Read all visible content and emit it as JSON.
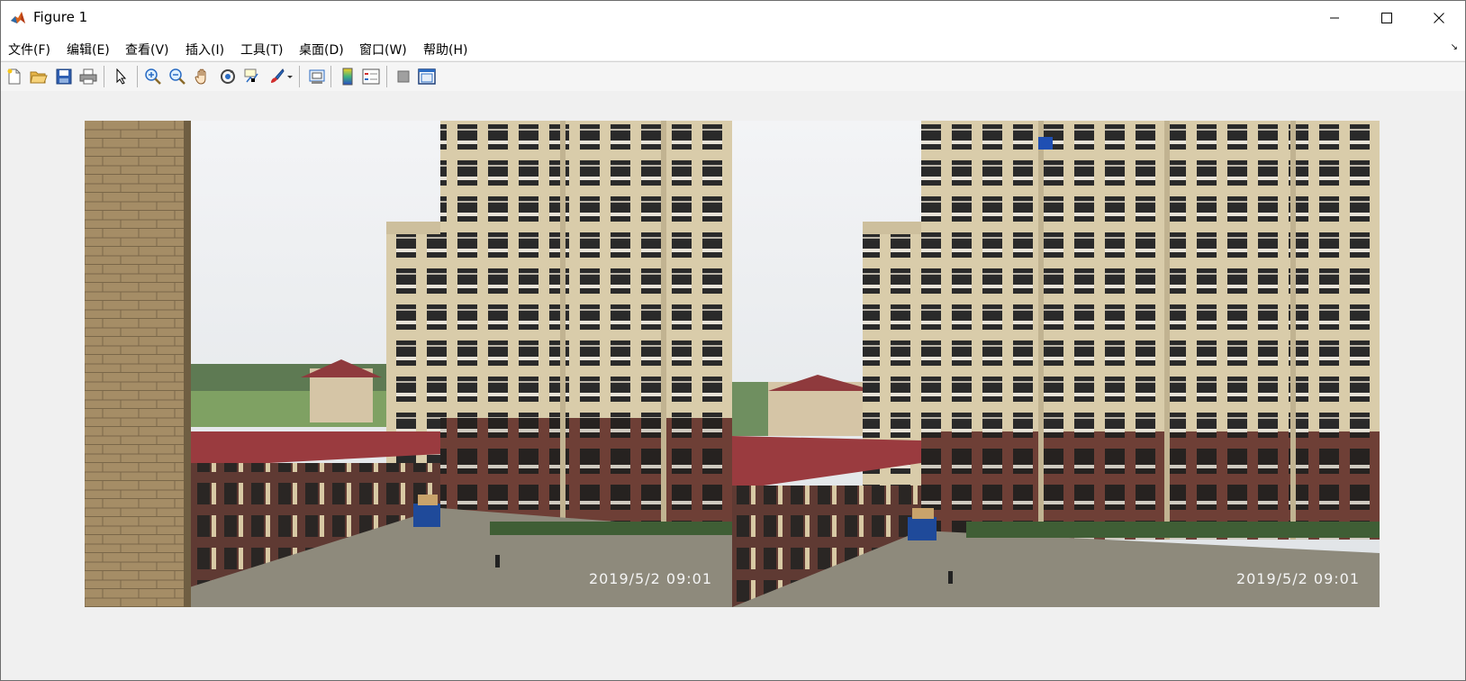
{
  "window": {
    "title": "Figure 1"
  },
  "menu": [
    "文件(F)",
    "编辑(E)",
    "查看(V)",
    "插入(I)",
    "工具(T)",
    "桌面(D)",
    "窗口(W)",
    "帮助(H)"
  ],
  "toolbar": {
    "icons": [
      "new-figure-icon",
      "open-file-icon",
      "save-icon",
      "print-icon",
      "select-arrow-icon",
      "zoom-in-icon",
      "zoom-out-icon",
      "pan-hand-icon",
      "rotate-3d-icon",
      "data-cursor-icon",
      "brush-icon",
      "link-plot-icon",
      "insert-colorbar-icon",
      "insert-legend-icon",
      "hide-plot-tools-icon",
      "show-plot-tools-icon"
    ]
  },
  "images": [
    {
      "timestamp": "2019/5/2  09:01"
    },
    {
      "timestamp": "2019/5/2  09:01"
    }
  ],
  "colors": {
    "brick_roof": "#9a3b3f",
    "tower_facade": "#d8c9a4",
    "tower_base": "#6e3f36",
    "sky": "#e6e8ec",
    "ground": "#8e8a7c"
  }
}
